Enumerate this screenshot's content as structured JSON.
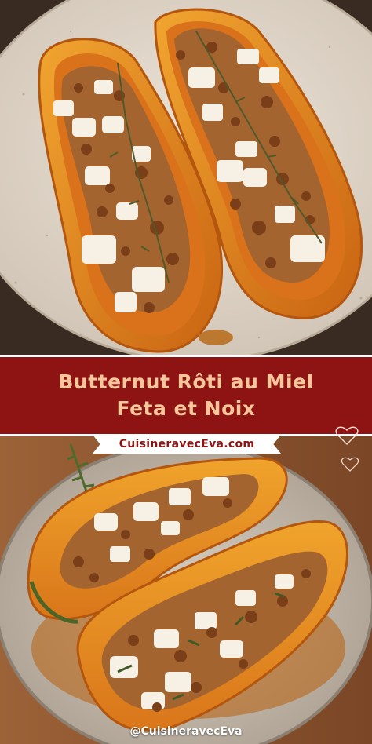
{
  "title": {
    "line1": "Butternut Rôti au Miel",
    "line2": "Feta et Noix"
  },
  "site": "CuisineravecEva.com",
  "handle": "@CuisineravecEva",
  "colors": {
    "banner": "#8e1414",
    "title_text": "#f7c79c",
    "squash": "#e88a1f",
    "feta": "#f6f1e4",
    "walnut": "#9a5a28"
  }
}
